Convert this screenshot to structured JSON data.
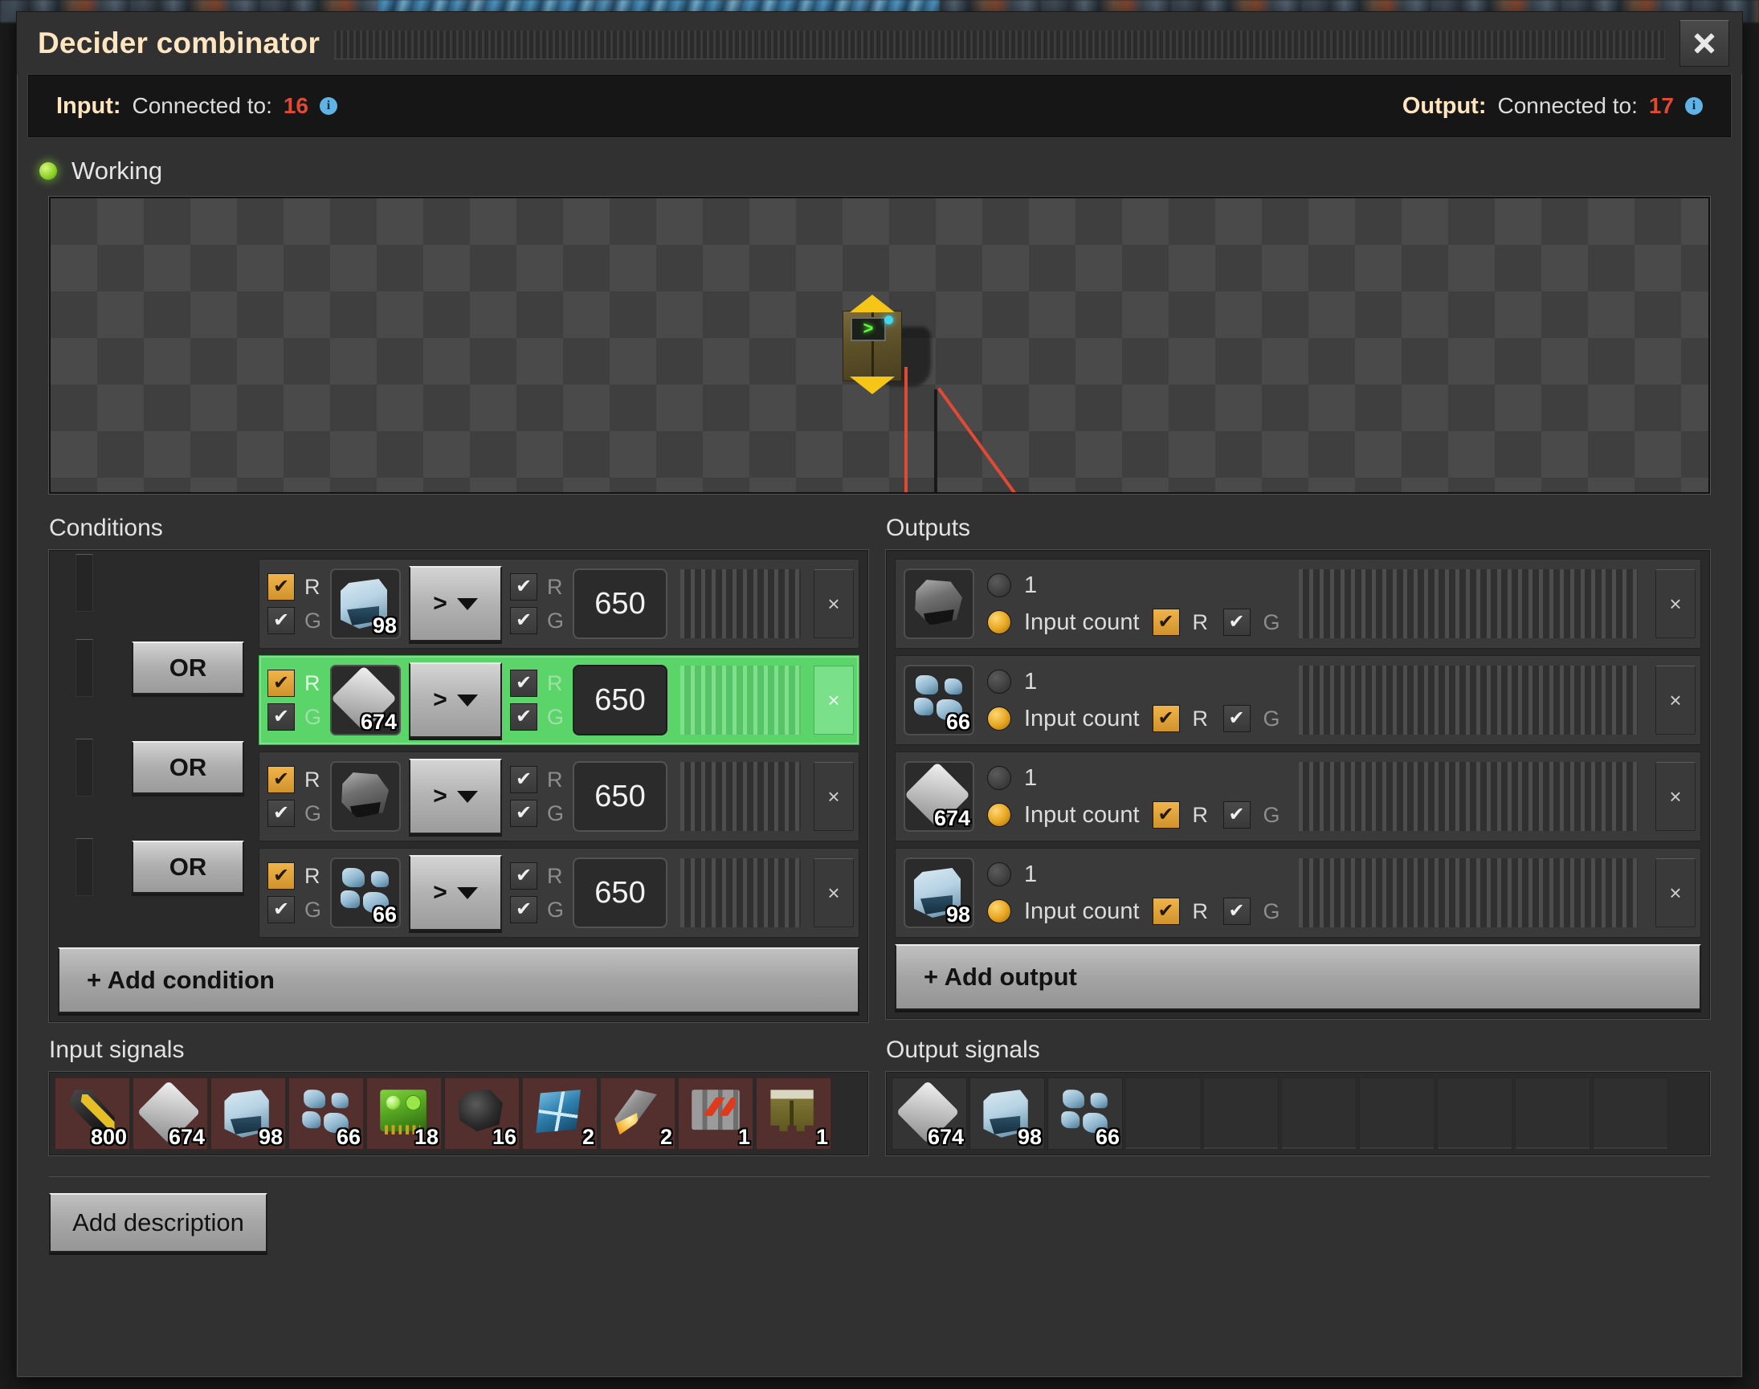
{
  "window": {
    "title": "Decider combinator",
    "close_label": "✕"
  },
  "connections": {
    "input_label": "Input:",
    "input_text": "Connected to:",
    "input_count": "16",
    "input_info_icon": "info-icon",
    "output_label": "Output:",
    "output_text": "Connected to:",
    "output_count": "17",
    "output_info_icon": "info-icon"
  },
  "status": {
    "text": "Working",
    "led_color": "#8fd42b"
  },
  "preview": {
    "entity_name": "decider-combinator",
    "screen_glyph": ">"
  },
  "conditions": {
    "title": "Conditions",
    "or_buttons": [
      "OR",
      "OR",
      "OR"
    ],
    "add_label": "+ Add condition",
    "rows": [
      {
        "left_red_checked": true,
        "left_green_checked": true,
        "left_r": "R",
        "left_g": "G",
        "signal_icon": "ice-icon",
        "signal_count": "98",
        "operator": "&gt;",
        "right_red_checked": true,
        "right_green_checked": true,
        "right_r": "R",
        "right_g": "G",
        "value": "650",
        "remove_label": "×",
        "selected": false
      },
      {
        "left_red_checked": true,
        "left_green_checked": true,
        "left_r": "R",
        "left_g": "G",
        "signal_icon": "iron-plate-icon",
        "signal_count": "674",
        "operator": "&gt;",
        "right_red_checked": true,
        "right_green_checked": true,
        "right_r": "R",
        "right_g": "G",
        "value": "650",
        "remove_label": "×",
        "selected": true
      },
      {
        "left_red_checked": true,
        "left_green_checked": true,
        "left_r": "R",
        "left_g": "G",
        "signal_icon": "stone-icon",
        "signal_count": "",
        "operator": "&gt;",
        "right_red_checked": true,
        "right_green_checked": true,
        "right_r": "R",
        "right_g": "G",
        "value": "650",
        "remove_label": "×",
        "selected": false
      },
      {
        "left_red_checked": true,
        "left_green_checked": true,
        "left_r": "R",
        "left_g": "G",
        "signal_icon": "ice-ore-icon",
        "signal_count": "66",
        "operator": "&gt;",
        "right_red_checked": true,
        "right_green_checked": true,
        "right_r": "R",
        "right_g": "G",
        "value": "650",
        "remove_label": "×",
        "selected": false
      }
    ]
  },
  "outputs": {
    "title": "Outputs",
    "add_label": "+ Add output",
    "rows": [
      {
        "signal_icon": "stone-icon",
        "signal_count": "",
        "constant_label": "1",
        "constant_selected": false,
        "input_count_label": "Input count",
        "input_count_selected": true,
        "red_checked": true,
        "green_checked": true,
        "r": "R",
        "g": "G",
        "remove_label": "×"
      },
      {
        "signal_icon": "ice-ore-icon",
        "signal_count": "66",
        "constant_label": "1",
        "constant_selected": false,
        "input_count_label": "Input count",
        "input_count_selected": true,
        "red_checked": true,
        "green_checked": true,
        "r": "R",
        "g": "G",
        "remove_label": "×"
      },
      {
        "signal_icon": "iron-plate-icon",
        "signal_count": "674",
        "constant_label": "1",
        "constant_selected": false,
        "input_count_label": "Input count",
        "input_count_selected": true,
        "red_checked": true,
        "green_checked": true,
        "r": "R",
        "g": "G",
        "remove_label": "×"
      },
      {
        "signal_icon": "ice-icon",
        "signal_count": "98",
        "constant_label": "1",
        "constant_selected": false,
        "input_count_label": "Input count",
        "input_count_selected": true,
        "red_checked": true,
        "green_checked": true,
        "r": "R",
        "g": "G",
        "remove_label": "×"
      }
    ]
  },
  "input_signals": {
    "title": "Input signals",
    "items": [
      {
        "icon": "rail-icon",
        "count": "800"
      },
      {
        "icon": "iron-plate-icon",
        "count": "674"
      },
      {
        "icon": "ice-icon",
        "count": "98"
      },
      {
        "icon": "ice-ore-icon",
        "count": "66"
      },
      {
        "icon": "electronic-circuit-icon",
        "count": "18"
      },
      {
        "icon": "coal-icon",
        "count": "16"
      },
      {
        "icon": "solar-panel-icon",
        "count": "2"
      },
      {
        "icon": "rocket-icon",
        "count": "2"
      },
      {
        "icon": "splitter-icon",
        "count": "1"
      },
      {
        "icon": "wall-icon",
        "count": "1"
      }
    ],
    "empty_slots": 0
  },
  "output_signals": {
    "title": "Output signals",
    "items": [
      {
        "icon": "iron-plate-icon",
        "count": "674"
      },
      {
        "icon": "ice-icon",
        "count": "98"
      },
      {
        "icon": "ice-ore-icon",
        "count": "66"
      }
    ],
    "empty_slots": 7
  },
  "footer": {
    "description_label": "Add description"
  },
  "colors": {
    "accent_orange": "#e5a41f",
    "title_cream": "#ffe6c0",
    "connection_red": "#e04a35",
    "selected_green": "#5bd469",
    "status_green": "#8fd42b"
  }
}
